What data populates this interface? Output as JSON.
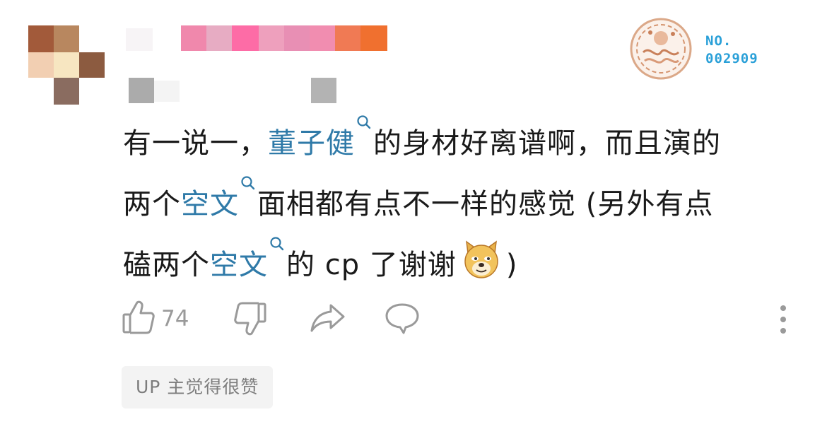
{
  "badge": {
    "no_label": "NO.",
    "no_value": "002909",
    "accent": "#2aa0d8"
  },
  "comment": {
    "line1_a": "有一说一，",
    "kw1": "董子健",
    "line1_b": "的身材好离谱啊，而且演的",
    "line2_a": "两个",
    "kw2": "空文",
    "line2_b": "面相都有点不一样的感觉 (另外有点",
    "line3_a": "磕两个",
    "kw3": "空文",
    "line3_b": "的 cp 了谢谢",
    "line3_c": ")",
    "keyword_color": "#2f7aa8"
  },
  "actions": {
    "like_count": "74",
    "icons": [
      "thumbs-up-icon",
      "thumbs-down-icon",
      "share-icon",
      "reply-icon",
      "more-vertical-icon"
    ]
  },
  "up_badge": {
    "label": "UP 主觉得很赞"
  }
}
